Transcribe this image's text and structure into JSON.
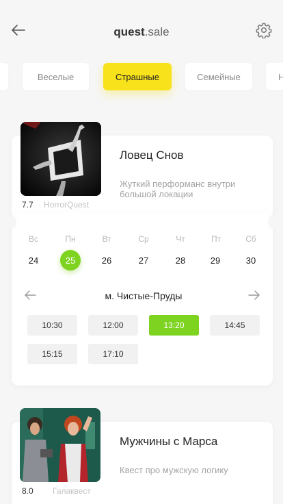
{
  "header": {
    "title_bold": "quest",
    "title_rest": ".sale"
  },
  "icons": {
    "back": "arrow-left-icon",
    "settings": "gear-icon"
  },
  "colors": {
    "accent_yellow": "#f7e21b",
    "accent_green": "#7ed321",
    "background": "#f6f6f7"
  },
  "categories": [
    "",
    "Веселые",
    "Страшные",
    "Семейные",
    "Н"
  ],
  "active_category": "Страшные",
  "quests": [
    {
      "name": "Ловец Снов",
      "description": "Жуткий перформанс внутри большой локации",
      "rating": "7.7",
      "company": "HorrorQuest"
    },
    {
      "name": "Мужчины с Марса",
      "description": "Квест про мужскую логику",
      "rating": "8.0",
      "company": "Галаквест"
    }
  ],
  "calendar": {
    "day_names": [
      "Вс",
      "Пн",
      "Вт",
      "Ср",
      "Чт",
      "Пт",
      "Сб"
    ],
    "day_numbers": [
      "24",
      "25",
      "26",
      "27",
      "28",
      "29",
      "30"
    ],
    "selected_day": "25"
  },
  "location": {
    "name": "м. Чистые-Пруды"
  },
  "timeslots": [
    "10:30",
    "12:00",
    "13:20",
    "14:45",
    "15:15",
    "17:10"
  ],
  "selected_time": "13:20"
}
